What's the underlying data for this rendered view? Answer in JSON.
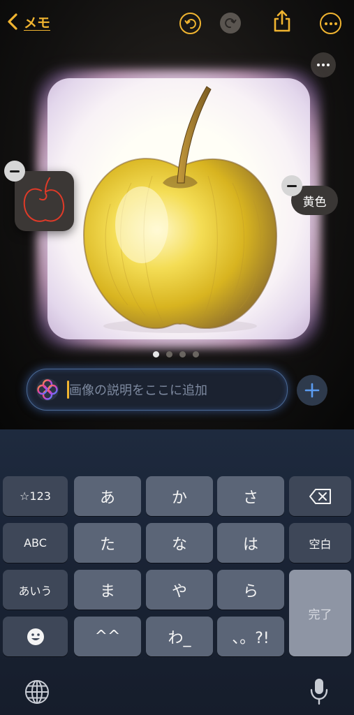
{
  "nav": {
    "back_label": "メモ",
    "back_icon": "chevron-left-icon",
    "undo_icon": "undo-icon",
    "redo_icon": "redo-icon",
    "share_icon": "share-icon",
    "more_icon": "more-icon"
  },
  "editor": {
    "image_subject": "yellow apple illustration",
    "tag_label": "黄色",
    "page_count": 4,
    "current_page": 1
  },
  "prompt": {
    "placeholder": "画像の説明をここに追加",
    "value": ""
  },
  "keyboard": {
    "rows": [
      [
        "☆123",
        "あ",
        "か",
        "さ",
        "⌫"
      ],
      [
        "ABC",
        "た",
        "な",
        "は",
        "空白"
      ],
      [
        "あいう",
        "ま",
        "や",
        "ら",
        "完了"
      ],
      [
        "☻",
        "^^",
        "わ_",
        "、。?!"
      ]
    ],
    "bottom_left_icon": "globe-icon",
    "bottom_right_icon": "microphone-icon"
  },
  "colors": {
    "accent": "#f0b430",
    "key": "#5b6577",
    "key_func": "#3e4758",
    "prompt_border": "#4b6a95"
  }
}
